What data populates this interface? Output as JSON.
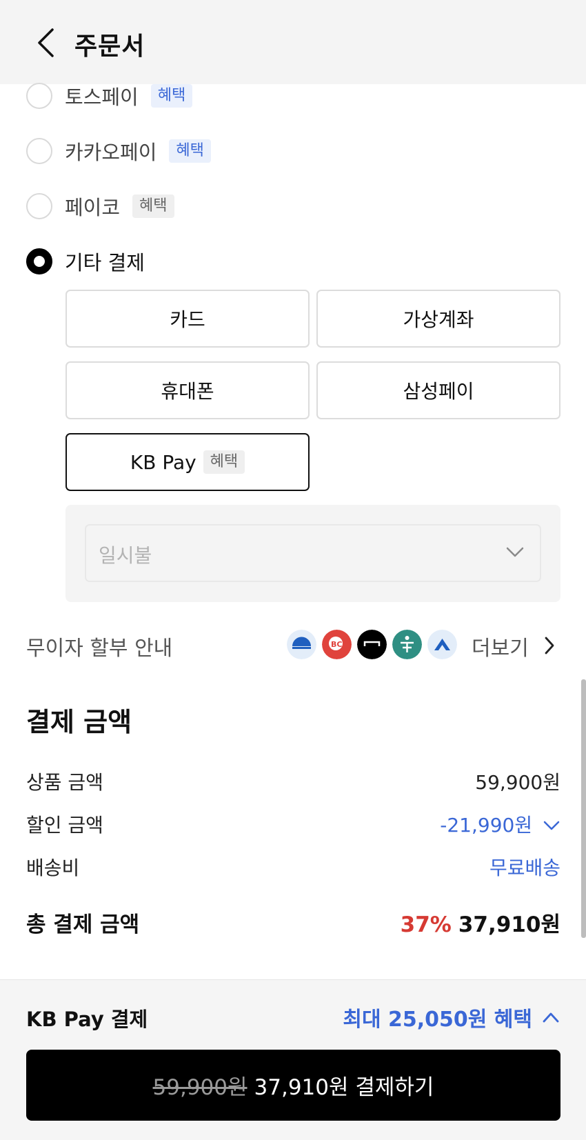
{
  "header": {
    "title": "주문서"
  },
  "payment_options": [
    {
      "label": "토스페이",
      "badge": "혜택",
      "selected": false
    },
    {
      "label": "카카오페이",
      "badge": "혜택",
      "selected": false
    },
    {
      "label": "페이코",
      "badge": "혜택",
      "selected": false
    },
    {
      "label": "기타 결제",
      "selected": true
    }
  ],
  "other_methods": [
    {
      "label": "카드"
    },
    {
      "label": "가상계좌"
    },
    {
      "label": "휴대폰"
    },
    {
      "label": "삼성페이"
    },
    {
      "label": "KB Pay",
      "badge": "혜택",
      "active": true
    }
  ],
  "installment": {
    "value": "일시불"
  },
  "interest_free": {
    "label": "무이자 할부 안내",
    "more": "더보기",
    "bank_icons": [
      "shinhan-card-icon",
      "bc-card-icon",
      "hyundai-card-icon",
      "hana-card-icon",
      "nh-card-icon"
    ]
  },
  "summary": {
    "title": "결제 금액",
    "rows": [
      {
        "label": "상품 금액",
        "value": "59,900원"
      },
      {
        "label": "할인 금액",
        "value": "-21,990원"
      },
      {
        "label": "배송비",
        "value": "무료배송"
      }
    ],
    "total_label": "총 결제 금액",
    "total_discount": "37%",
    "total_value": "37,910원"
  },
  "bottom": {
    "method_label": "KB Pay 결제",
    "benefit": "최대 25,050원 혜택",
    "original_price": "59,900원",
    "pay_label": "37,910원 결제하기"
  },
  "colors": {
    "accent_blue": "#3a67d6",
    "discount_red": "#d63a33",
    "pay_button": "#000000"
  }
}
